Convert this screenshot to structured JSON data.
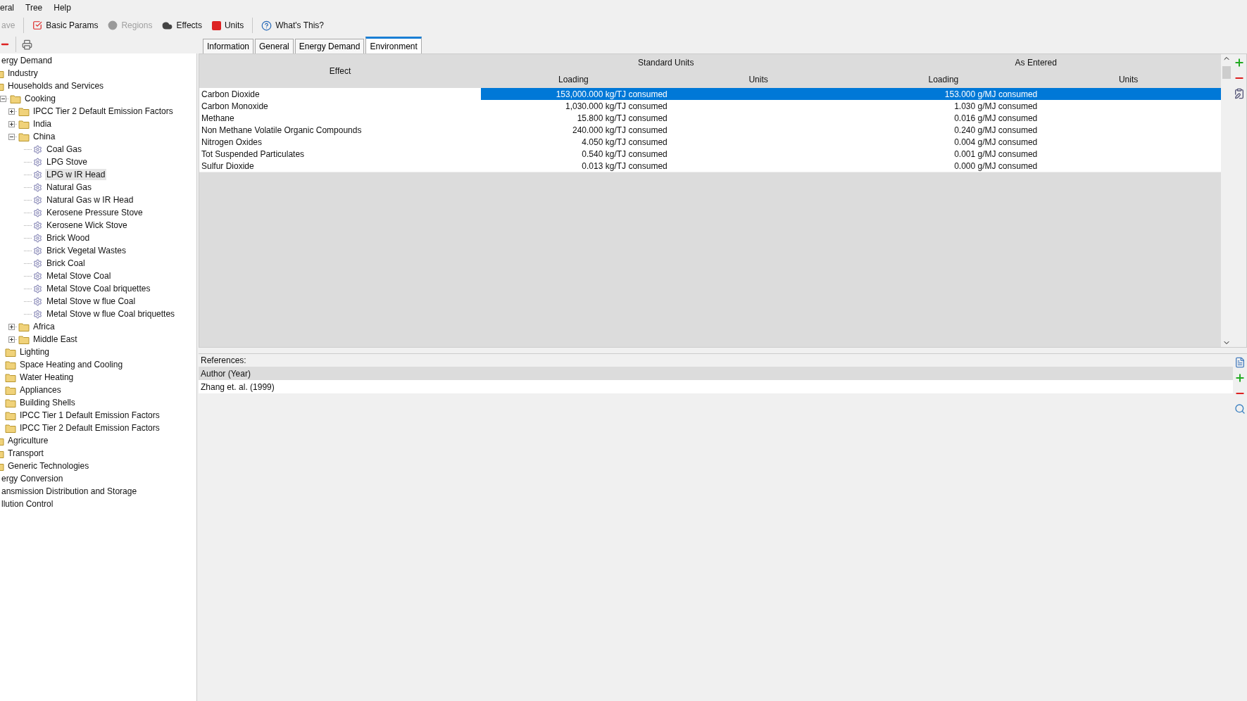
{
  "menu": [
    {
      "label": "eral"
    },
    {
      "label": "Tree"
    },
    {
      "label": "Help"
    }
  ],
  "toolbar": [
    {
      "kind": "save",
      "label": "ave",
      "disabled": true
    },
    {
      "kind": "params",
      "label": "Basic Params",
      "disabled": false
    },
    {
      "kind": "regions",
      "label": "Regions",
      "disabled": true
    },
    {
      "kind": "effects",
      "label": "Effects",
      "disabled": false
    },
    {
      "kind": "units",
      "label": "Units",
      "disabled": false
    },
    {
      "kind": "help",
      "label": "What's This?",
      "disabled": false
    }
  ],
  "tabs": [
    {
      "label": "Information",
      "selected": false
    },
    {
      "label": "General",
      "selected": false
    },
    {
      "label": "Energy Demand",
      "selected": false
    },
    {
      "label": "Environment",
      "selected": true
    }
  ],
  "tree": [
    {
      "label": "ergy Demand",
      "selected": false,
      "children": [
        {
          "label": "Industry",
          "kind": "folder",
          "selected": false
        },
        {
          "label": "Households and Services",
          "kind": "folder",
          "selected": false,
          "children": [
            {
              "label": "Cooking",
              "kind": "folder",
              "expanded": true,
              "selected": false,
              "children": [
                {
                  "label": "IPCC Tier 2 Default Emission Factors",
                  "kind": "folder",
                  "expanded": false,
                  "selected": false
                },
                {
                  "label": "India",
                  "kind": "folder",
                  "expanded": false,
                  "selected": false
                },
                {
                  "label": "China",
                  "kind": "folder",
                  "expanded": true,
                  "selected": false,
                  "children": [
                    {
                      "label": "Coal Gas",
                      "kind": "tech",
                      "selected": false
                    },
                    {
                      "label": "LPG Stove",
                      "kind": "tech",
                      "selected": false
                    },
                    {
                      "label": "LPG w IR Head",
                      "kind": "tech",
                      "selected": true
                    },
                    {
                      "label": "Natural Gas",
                      "kind": "tech",
                      "selected": false
                    },
                    {
                      "label": "Natural Gas w IR Head",
                      "kind": "tech",
                      "selected": false
                    },
                    {
                      "label": "Kerosene Pressure Stove",
                      "kind": "tech",
                      "selected": false
                    },
                    {
                      "label": "Kerosene Wick Stove",
                      "kind": "tech",
                      "selected": false
                    },
                    {
                      "label": "Brick Wood",
                      "kind": "tech",
                      "selected": false
                    },
                    {
                      "label": "Brick Vegetal Wastes",
                      "kind": "tech",
                      "selected": false
                    },
                    {
                      "label": "Brick Coal",
                      "kind": "tech",
                      "selected": false
                    },
                    {
                      "label": "Metal Stove Coal",
                      "kind": "tech",
                      "selected": false
                    },
                    {
                      "label": "Metal Stove Coal briquettes",
                      "kind": "tech",
                      "selected": false
                    },
                    {
                      "label": "Metal Stove w flue Coal",
                      "kind": "tech",
                      "selected": false
                    },
                    {
                      "label": "Metal Stove w flue Coal briquettes",
                      "kind": "tech",
                      "selected": false
                    }
                  ]
                },
                {
                  "label": "Africa",
                  "kind": "folder",
                  "expanded": false,
                  "selected": false
                },
                {
                  "label": "Middle East",
                  "kind": "folder",
                  "expanded": false,
                  "selected": false
                }
              ]
            },
            {
              "label": "Lighting",
              "kind": "folder",
              "selected": false
            },
            {
              "label": "Space Heating and Cooling",
              "kind": "folder",
              "selected": false
            },
            {
              "label": "Water Heating",
              "kind": "folder",
              "selected": false
            },
            {
              "label": "Appliances",
              "kind": "folder",
              "selected": false
            },
            {
              "label": "Building Shells",
              "kind": "folder",
              "selected": false
            },
            {
              "label": "IPCC Tier 1 Default Emission Factors",
              "kind": "folder",
              "selected": false
            },
            {
              "label": "IPCC Tier 2 Default Emission Factors",
              "kind": "folder",
              "selected": false
            }
          ]
        },
        {
          "label": "Agriculture",
          "kind": "folder",
          "selected": false
        },
        {
          "label": "Transport",
          "kind": "folder",
          "selected": false
        },
        {
          "label": "Generic Technologies",
          "kind": "folder",
          "selected": false
        }
      ]
    },
    {
      "label": "ergy Conversion",
      "selected": false
    },
    {
      "label": "ansmission Distribution and Storage",
      "selected": false
    },
    {
      "label": "llution Control",
      "selected": false
    }
  ],
  "effects_table": {
    "effect_header": "Effect",
    "groups": [
      {
        "title": "Standard Units",
        "loading": "Loading",
        "units": "Units"
      },
      {
        "title": "As Entered",
        "loading": "Loading",
        "units": "Units"
      }
    ],
    "rows": [
      {
        "effect": "Carbon Dioxide",
        "standard": "153,000.000 kg/TJ consumed",
        "entered": "153.000 g/MJ consumed",
        "selected": true
      },
      {
        "effect": "Carbon Monoxide",
        "standard": "1,030.000 kg/TJ consumed",
        "entered": "1.030 g/MJ consumed",
        "selected": false
      },
      {
        "effect": "Methane",
        "standard": "15.800 kg/TJ consumed",
        "entered": "0.016 g/MJ consumed",
        "selected": false
      },
      {
        "effect": "Non Methane Volatile Organic Compounds",
        "standard": "240.000 kg/TJ consumed",
        "entered": "0.240 g/MJ consumed",
        "selected": false
      },
      {
        "effect": "Nitrogen Oxides",
        "standard": "4.050 kg/TJ consumed",
        "entered": "0.004 g/MJ consumed",
        "selected": false
      },
      {
        "effect": "Tot Suspended Particulates",
        "standard": "0.540 kg/TJ consumed",
        "entered": "0.001 g/MJ consumed",
        "selected": false
      },
      {
        "effect": "Sulfur Dioxide",
        "standard": "0.013 kg/TJ consumed",
        "entered": "0.000 g/MJ consumed",
        "selected": false
      }
    ]
  },
  "references": {
    "label": "References:",
    "header": "Author (Year)",
    "rows": [
      "Zhang et. al. (1999)"
    ]
  }
}
